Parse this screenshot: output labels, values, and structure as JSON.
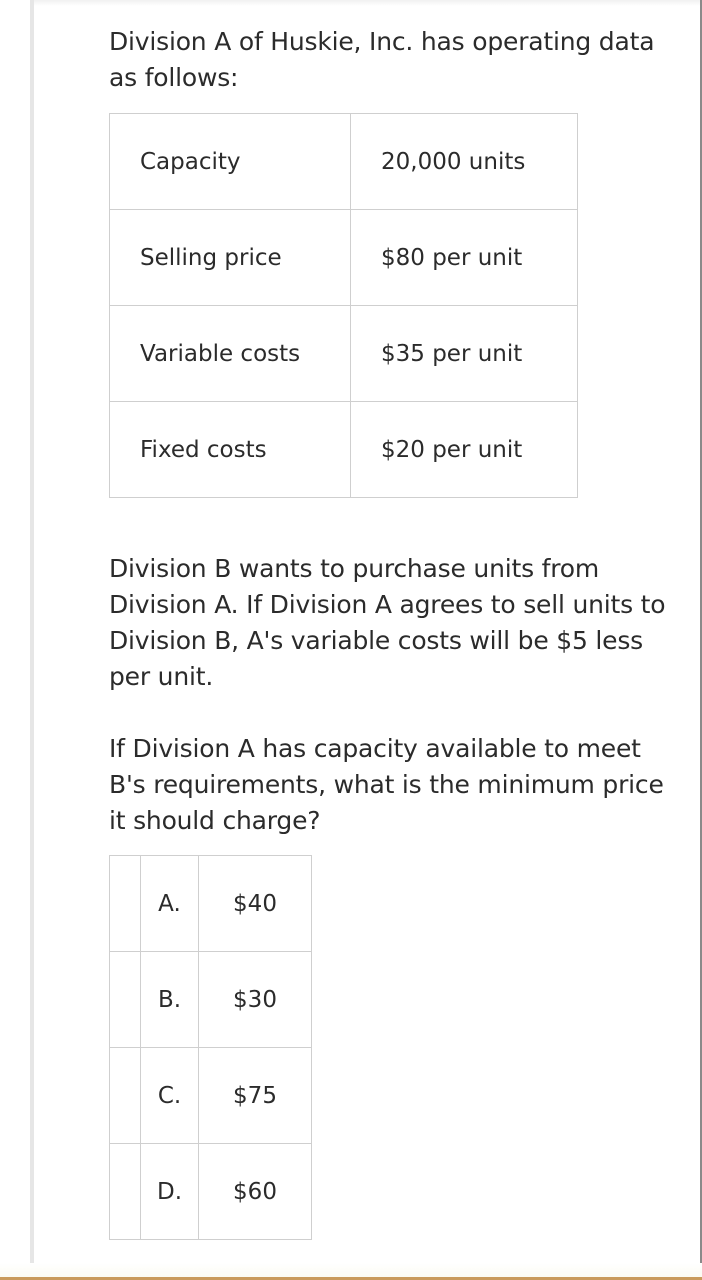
{
  "question": {
    "intro": "Division A of Huskie, Inc. has operating data as follows:",
    "data_table": {
      "rows": [
        {
          "label": "Capacity",
          "value": "20,000 units"
        },
        {
          "label": "Selling price",
          "value": "$80 per unit"
        },
        {
          "label": "Variable costs",
          "value": "$35 per unit"
        },
        {
          "label": "Fixed costs",
          "value": "$20 per unit"
        }
      ]
    },
    "paragraph_1": "Division B wants to purchase units from Division A. If Division A agrees to sell units to Division B, A's variable costs will be $5 less per unit.",
    "paragraph_2": "If Division A has capacity available to meet B's requirements, what is the minimum price it should charge?",
    "options": [
      {
        "letter": "A.",
        "text": "$40"
      },
      {
        "letter": "B.",
        "text": "$30"
      },
      {
        "letter": "C.",
        "text": "$75"
      },
      {
        "letter": "D.",
        "text": "$60"
      }
    ]
  },
  "colors": {
    "text": "#2b2b2b",
    "border": "#cfcfcf",
    "bottom_strip": "#c99a5b"
  }
}
